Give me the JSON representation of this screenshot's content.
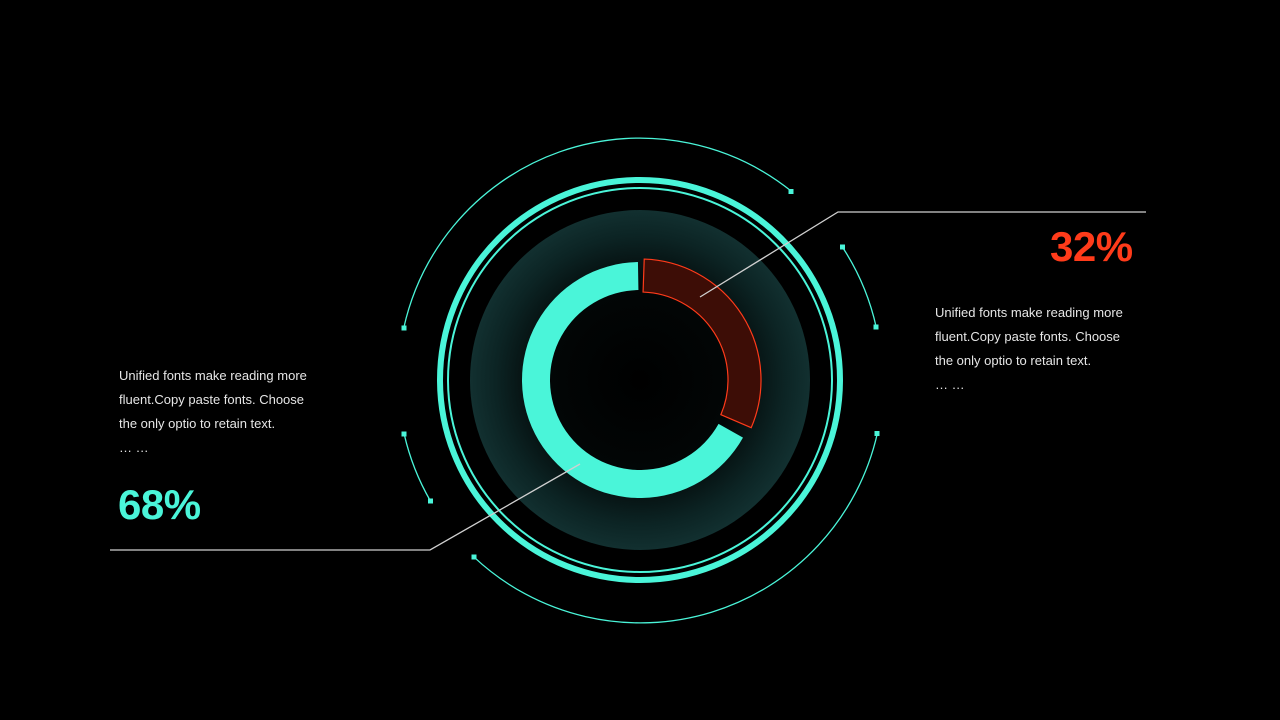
{
  "colors": {
    "background": "#000000",
    "primary_accent": "#4af5d9",
    "secondary_accent": "#ff3b1a",
    "secondary_fill": "#3d0d06",
    "inner_glow": "#0f2a2a",
    "text": "#e6e6e6",
    "leader_line": "#d0d0d0"
  },
  "chart_data": {
    "type": "pie",
    "style": "donut",
    "slices": [
      {
        "value": 68,
        "label": "68%",
        "color": "#4af5d9"
      },
      {
        "value": 32,
        "label": "32%",
        "color": "#ff3b1a"
      }
    ]
  },
  "left_panel": {
    "lines": [
      "Unified fonts make reading more",
      "fluent.Copy paste fonts. Choose",
      "the only optio to retain text.",
      "… …"
    ],
    "percent": "68%"
  },
  "right_panel": {
    "lines": [
      "Unified fonts make reading more",
      "fluent.Copy paste fonts. Choose",
      "the only optio to retain text.",
      "… …"
    ],
    "percent": "32%"
  }
}
